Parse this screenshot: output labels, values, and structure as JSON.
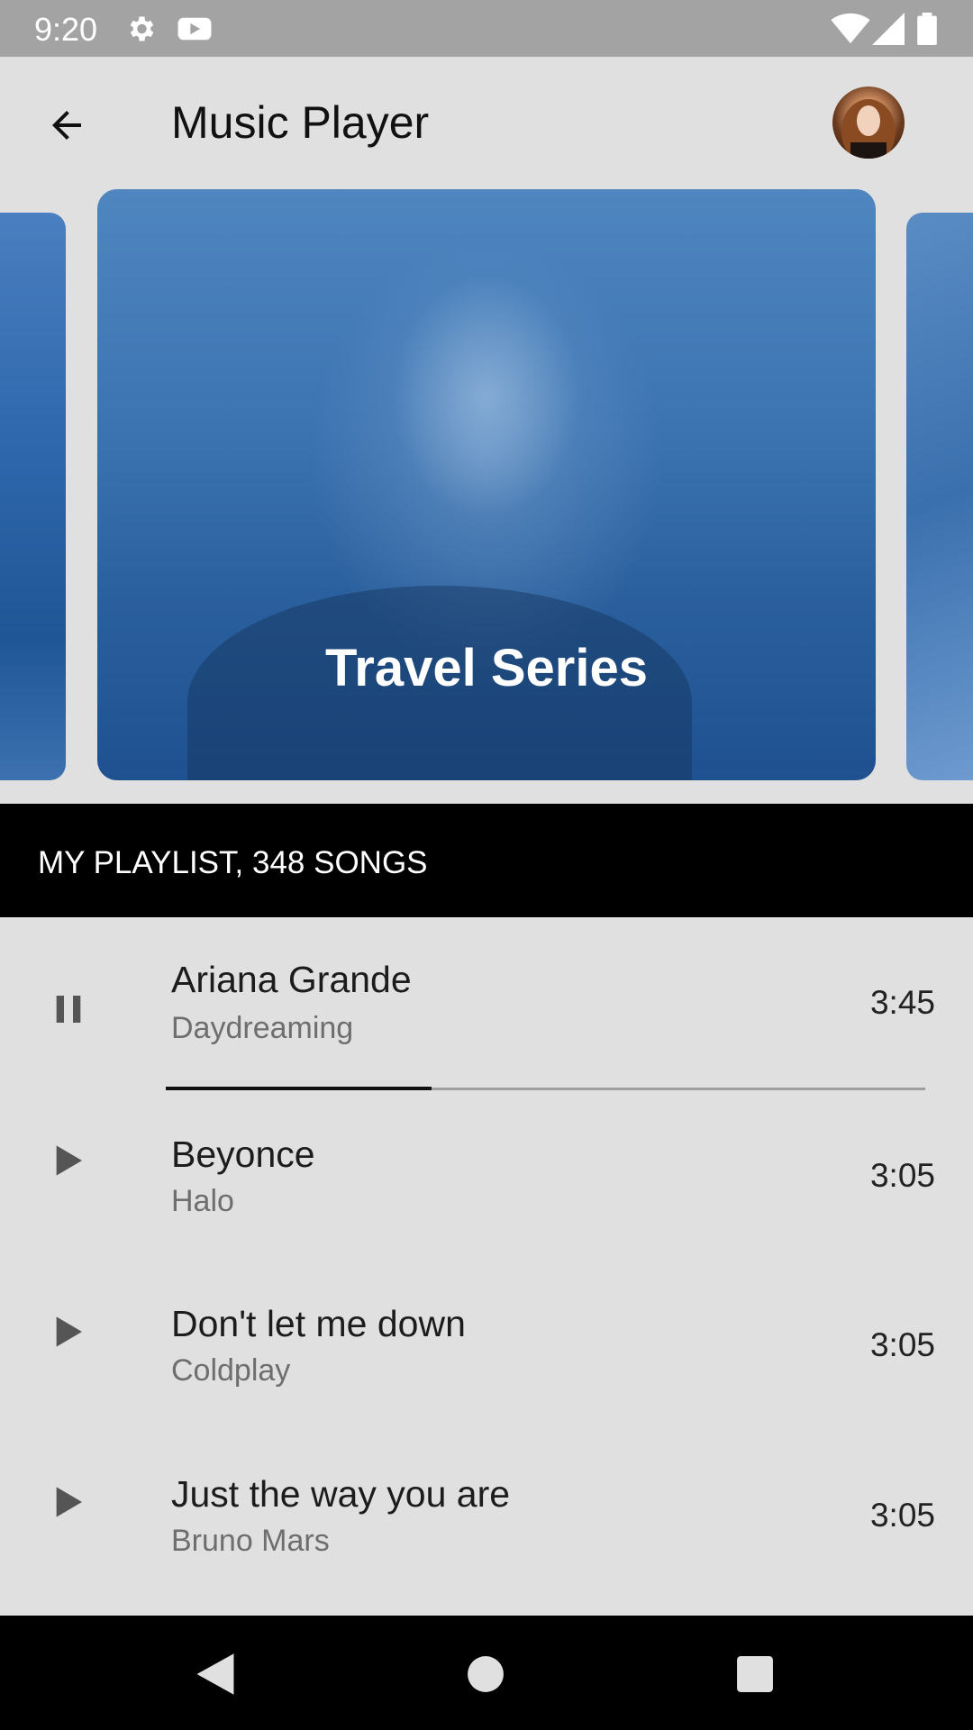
{
  "status_bar": {
    "time": "9:20",
    "icons": [
      "gear-icon",
      "youtube-icon",
      "wifi-icon",
      "signal-icon",
      "battery-icon"
    ]
  },
  "app_bar": {
    "title": "Music Player",
    "back_icon": "arrow-back-icon"
  },
  "carousel": {
    "current_title": "Travel Series",
    "accent_color": "#2f68ad"
  },
  "playlist": {
    "header": "MY PLAYLIST, 348 SONGS",
    "songs": [
      {
        "title": "Ariana Grande",
        "artist": "Daydreaming",
        "duration": "3:45",
        "state": "playing",
        "icon": "pause-icon"
      },
      {
        "title": "Beyonce",
        "artist": "Halo",
        "duration": "3:05",
        "state": "paused",
        "icon": "play-icon"
      },
      {
        "title": "Don't let me down",
        "artist": "Coldplay",
        "duration": "3:05",
        "state": "paused",
        "icon": "play-icon"
      },
      {
        "title": "Just the way you are",
        "artist": "Bruno Mars",
        "duration": "3:05",
        "state": "paused",
        "icon": "play-icon"
      }
    ],
    "progress_fraction": 0.35
  },
  "nav_bar": {
    "icons": [
      "nav-back-icon",
      "nav-home-icon",
      "nav-recents-icon"
    ]
  }
}
